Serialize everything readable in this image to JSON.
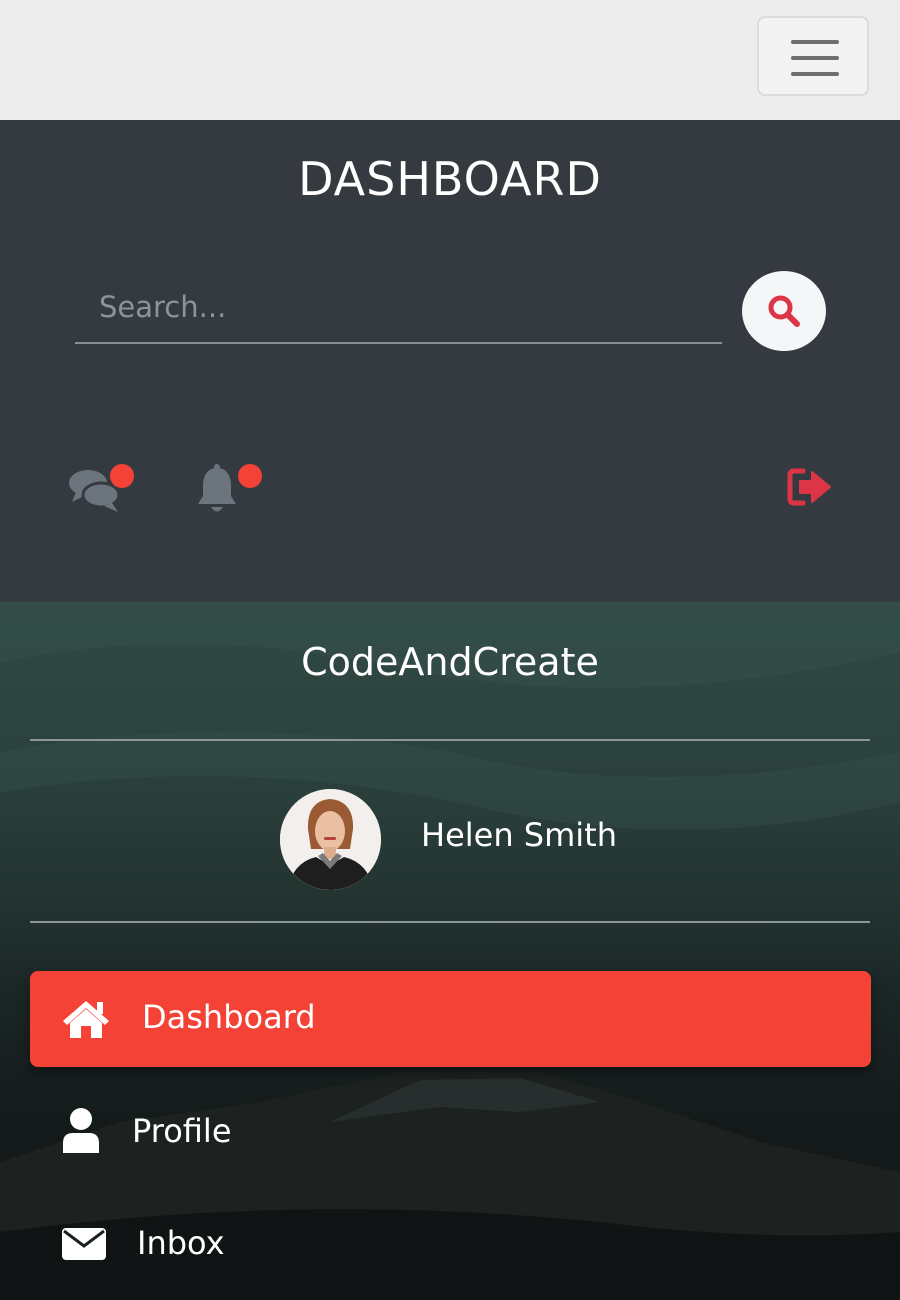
{
  "topbar": {
    "menu_icon": "hamburger-icon"
  },
  "header": {
    "title": "DASHBOARD",
    "search": {
      "placeholder": "Search...",
      "value": "",
      "button_icon": "search-icon"
    },
    "actions": [
      {
        "icon": "comments-icon",
        "has_badge": true
      },
      {
        "icon": "bell-icon",
        "has_badge": true
      },
      {
        "icon": "sign-out-icon"
      }
    ]
  },
  "sidebar": {
    "brand": "CodeAndCreate",
    "user": {
      "name": "Helen Smith",
      "avatar_icon": "avatar"
    },
    "items": [
      {
        "label": "Dashboard",
        "icon": "home-icon",
        "active": true
      },
      {
        "label": "Profile",
        "icon": "user-icon",
        "active": false
      },
      {
        "label": "Inbox",
        "icon": "envelope-icon",
        "active": false
      }
    ]
  },
  "colors": {
    "header_bg": "#343a40",
    "accent": "#f44336",
    "search_icon": "#dc3545",
    "logout_icon": "#dc3545",
    "muted_icon": "#6c757d"
  }
}
